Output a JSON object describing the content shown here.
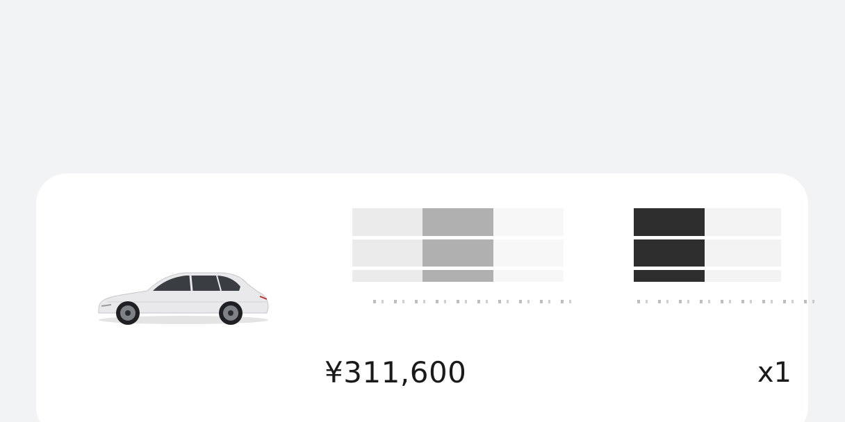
{
  "order_item": {
    "product_image": "white-suv-car-image",
    "variant_colors": [
      "#ebebeb",
      "#b0b0b0",
      "#f7f7f7",
      "#ffffff",
      "#2e2e2e",
      "#f3f3f3"
    ],
    "price": "¥311,600",
    "quantity": "x1"
  }
}
